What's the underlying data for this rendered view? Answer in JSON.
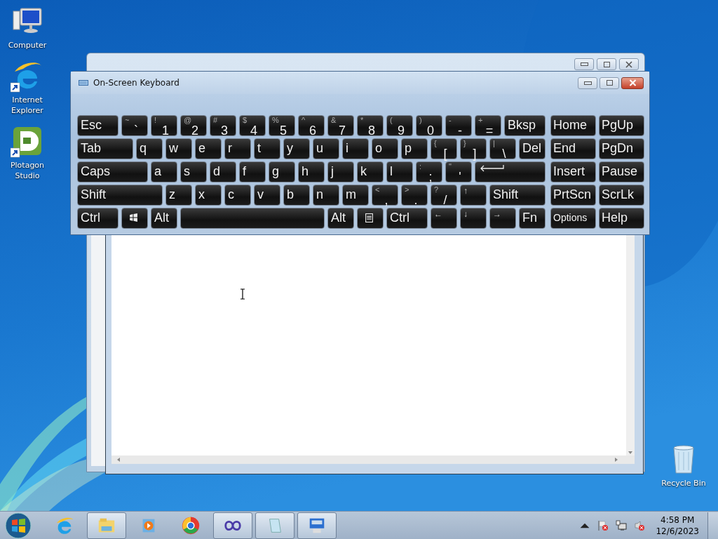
{
  "desktop_icons": [
    {
      "label": "Computer",
      "shortcut": false
    },
    {
      "label": "Internet Explorer",
      "shortcut": true
    },
    {
      "label": "Plotagon Studio",
      "shortcut": true
    }
  ],
  "recycle_bin": {
    "label": "Recycle Bin"
  },
  "keyboard": {
    "title": "On-Screen Keyboard",
    "rows": [
      {
        "keys": [
          {
            "kind": "wide",
            "label": "Esc"
          },
          {
            "kind": "key",
            "label": "`",
            "shift": "~"
          },
          {
            "kind": "key",
            "label": "1",
            "shift": "!"
          },
          {
            "kind": "key",
            "label": "2",
            "shift": "@"
          },
          {
            "kind": "key",
            "label": "3",
            "shift": "#"
          },
          {
            "kind": "key",
            "label": "4",
            "shift": "$"
          },
          {
            "kind": "key",
            "label": "5",
            "shift": "%"
          },
          {
            "kind": "key",
            "label": "6",
            "shift": "^"
          },
          {
            "kind": "key",
            "label": "7",
            "shift": "&"
          },
          {
            "kind": "key",
            "label": "8",
            "shift": "*"
          },
          {
            "kind": "key",
            "label": "9",
            "shift": "("
          },
          {
            "kind": "key",
            "label": "0",
            "shift": ")"
          },
          {
            "kind": "key",
            "label": "-",
            "shift": "-"
          },
          {
            "kind": "key",
            "label": "=",
            "shift": "+"
          },
          {
            "kind": "wide",
            "label": "Bksp"
          }
        ],
        "nav": [
          {
            "kind": "nav",
            "label": "Home"
          },
          {
            "kind": "nav",
            "label": "PgUp"
          }
        ]
      },
      {
        "keys": [
          {
            "kind": "double",
            "label": "Tab"
          },
          {
            "kind": "key",
            "label": "q"
          },
          {
            "kind": "key",
            "label": "w"
          },
          {
            "kind": "key",
            "label": "e"
          },
          {
            "kind": "key",
            "label": "r"
          },
          {
            "kind": "key",
            "label": "t"
          },
          {
            "kind": "key",
            "label": "y"
          },
          {
            "kind": "key",
            "label": "u"
          },
          {
            "kind": "key",
            "label": "i"
          },
          {
            "kind": "key",
            "label": "o"
          },
          {
            "kind": "key",
            "label": "p"
          },
          {
            "kind": "key",
            "label": "[",
            "shift": "{"
          },
          {
            "kind": "key",
            "label": "]",
            "shift": "}"
          },
          {
            "kind": "key",
            "label": "\\",
            "shift": "|"
          },
          {
            "kind": "key",
            "label": "Del"
          }
        ],
        "nav": [
          {
            "kind": "nav",
            "label": "End"
          },
          {
            "kind": "nav",
            "label": "PgDn"
          }
        ]
      },
      {
        "keys": [
          {
            "kind": "large",
            "label": "Caps"
          },
          {
            "kind": "key",
            "label": "a"
          },
          {
            "kind": "key",
            "label": "s"
          },
          {
            "kind": "key",
            "label": "d"
          },
          {
            "kind": "key",
            "label": "f"
          },
          {
            "kind": "key",
            "label": "g"
          },
          {
            "kind": "key",
            "label": "h"
          },
          {
            "kind": "key",
            "label": "j"
          },
          {
            "kind": "key",
            "label": "k"
          },
          {
            "kind": "key",
            "label": "l"
          },
          {
            "kind": "key",
            "label": ";",
            "shift": ":"
          },
          {
            "kind": "key",
            "label": "'",
            "shift": "\""
          },
          {
            "kind": "enter"
          }
        ],
        "nav": [
          {
            "kind": "nav",
            "label": "Insert"
          },
          {
            "kind": "nav",
            "label": "Pause"
          }
        ]
      },
      {
        "keys": [
          {
            "kind": "triple",
            "label": "Shift"
          },
          {
            "kind": "key",
            "label": "z"
          },
          {
            "kind": "key",
            "label": "x"
          },
          {
            "kind": "key",
            "label": "c"
          },
          {
            "kind": "key",
            "label": "v"
          },
          {
            "kind": "key",
            "label": "b"
          },
          {
            "kind": "key",
            "label": "n"
          },
          {
            "kind": "key",
            "label": "m"
          },
          {
            "kind": "key",
            "label": ",",
            "shift": "<"
          },
          {
            "kind": "key",
            "label": ".",
            "shift": ">"
          },
          {
            "kind": "key",
            "label": "/",
            "shift": "?"
          },
          {
            "kind": "arrow",
            "label": "↑"
          },
          {
            "kind": "double",
            "label": "Shift"
          }
        ],
        "nav": [
          {
            "kind": "nav",
            "label": "PrtScn"
          },
          {
            "kind": "nav",
            "label": "ScrLk"
          }
        ]
      },
      {
        "keys": [
          {
            "kind": "wide",
            "label": "Ctrl"
          },
          {
            "kind": "win"
          },
          {
            "kind": "key",
            "label": "Alt"
          },
          {
            "kind": "space"
          },
          {
            "kind": "key",
            "label": "Alt"
          },
          {
            "kind": "menu"
          },
          {
            "kind": "wide",
            "label": "Ctrl"
          },
          {
            "kind": "arrow",
            "label": "←"
          },
          {
            "kind": "arrow",
            "label": "↓"
          },
          {
            "kind": "arrow",
            "label": "→"
          },
          {
            "kind": "key",
            "label": "Fn"
          }
        ],
        "nav": [
          {
            "kind": "option",
            "label": "Options"
          },
          {
            "kind": "nav",
            "label": "Help"
          }
        ]
      }
    ]
  },
  "taskbar": {
    "items": [
      {
        "running": false
      },
      {
        "running": true
      },
      {
        "running": false
      },
      {
        "running": false
      },
      {
        "running": true
      },
      {
        "running": true
      },
      {
        "running": true
      }
    ],
    "clock": {
      "time": "4:58 PM",
      "date": "12/6/2023"
    }
  }
}
